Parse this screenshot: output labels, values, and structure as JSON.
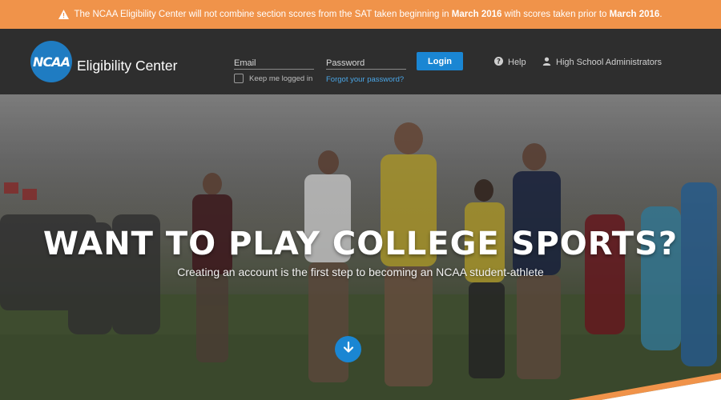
{
  "alert": {
    "text_before": "The NCAA Eligibility Center will not combine section scores from the SAT taken beginning in",
    "date1": "March 2016",
    "text_middle": "with scores taken prior to",
    "date2": "March 2016",
    "text_after": "."
  },
  "header": {
    "logo_mark": "NCAA",
    "logo_text": "Eligibility Center",
    "email_placeholder": "Email",
    "password_placeholder": "Password",
    "login_label": "Login",
    "keep_logged_in": "Keep me logged in",
    "forgot_password": "Forgot your password?",
    "help_label": "Help",
    "admins_label": "High School Administrators"
  },
  "hero": {
    "title": "WANT TO PLAY COLLEGE SPORTS?",
    "subtitle": "Creating an account is the first step to becoming an NCAA student-athlete"
  },
  "colors": {
    "alert_bg": "#f0934a",
    "header_bg": "#2e2e2e",
    "accent_blue": "#1a86d3",
    "link_blue": "#4aa6e6"
  },
  "icons": [
    "warning-icon",
    "help-icon",
    "user-icon",
    "arrow-down-icon"
  ]
}
